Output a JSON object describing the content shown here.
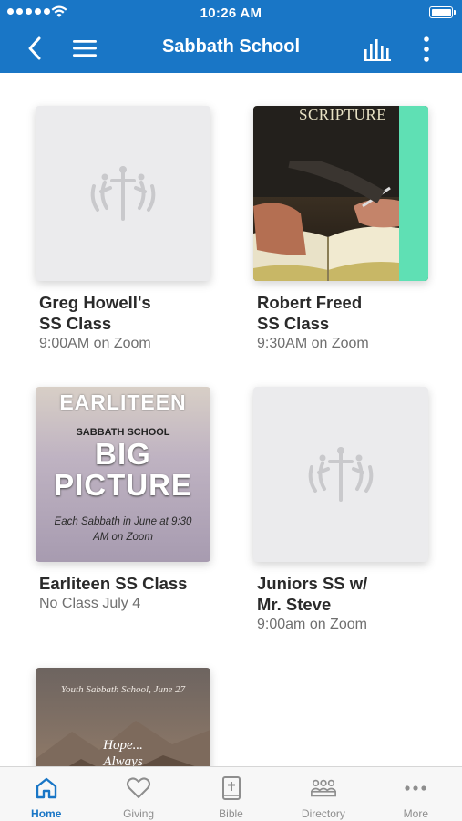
{
  "status_bar": {
    "time": "10:26 AM"
  },
  "header": {
    "title": "Sabbath School"
  },
  "cards": [
    {
      "title": "Greg Howell's\nSS Class",
      "subtitle": "9:00AM on Zoom"
    },
    {
      "title": "Robert Freed\nSS Class",
      "subtitle": "9:30AM on Zoom",
      "image_text": "SCRIPTURE"
    },
    {
      "title": "Earliteen SS Class",
      "subtitle": "No Class July 4",
      "image_text": {
        "line1": "EARLITEEN",
        "line2": "SABBATH SCHOOL",
        "line3": "BIG\nPICTURE",
        "line4": "Each Sabbath in June at 9:30\nAM on Zoom"
      }
    },
    {
      "title": "Juniors SS w/\nMr. Steve",
      "subtitle": "9:00am on Zoom"
    },
    {
      "title": "",
      "subtitle": "",
      "image_text": {
        "line1": "Youth Sabbath School, June 27",
        "line2": "Hope...\nAlways"
      }
    }
  ],
  "tabs": [
    {
      "label": "Home",
      "icon": "home-icon",
      "active": true
    },
    {
      "label": "Giving",
      "icon": "heart-icon"
    },
    {
      "label": "Bible",
      "icon": "bible-icon"
    },
    {
      "label": "Directory",
      "icon": "directory-icon"
    },
    {
      "label": "More",
      "icon": "more-icon"
    }
  ],
  "colors": {
    "header": "#1976c6",
    "active_tab": "#1976c6",
    "inactive_tab": "#8e8e8e"
  }
}
